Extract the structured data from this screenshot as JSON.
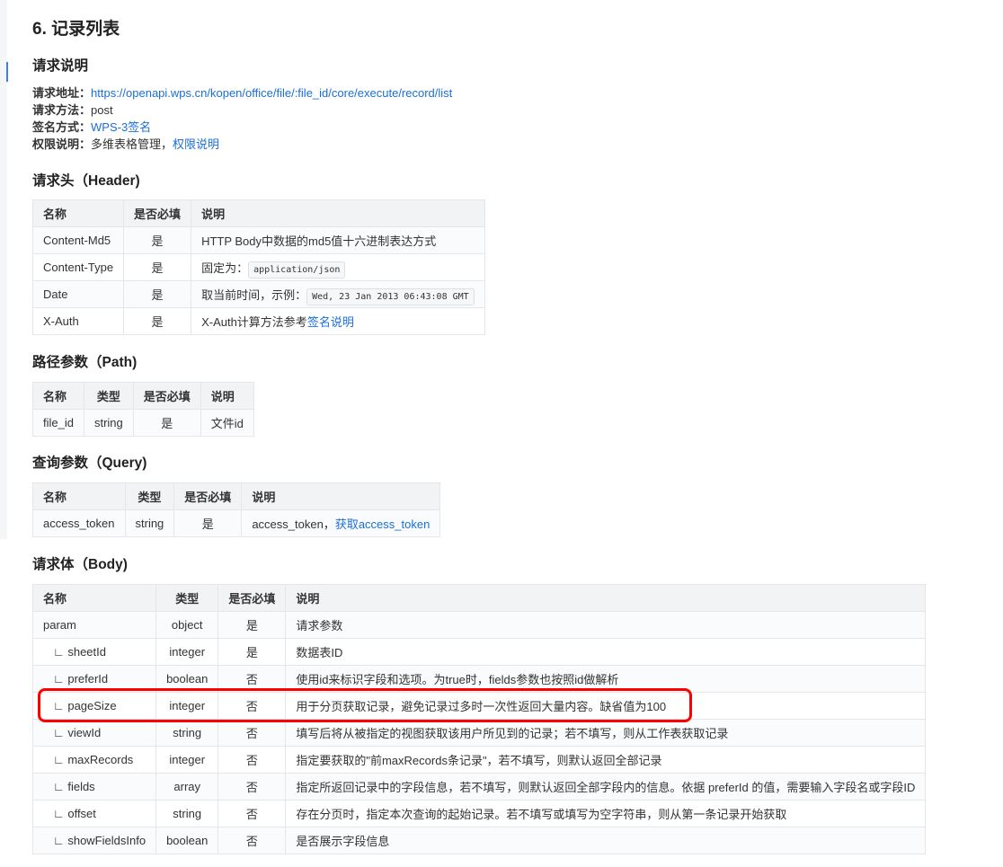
{
  "title": "6. 记录列表",
  "request_desc": {
    "heading": "请求说明",
    "rows": [
      {
        "label": "请求地址：",
        "value": "",
        "link": "https://openapi.wps.cn/kopen/office/file/:file_id/core/execute/record/list"
      },
      {
        "label": "请求方法：",
        "value": "post",
        "link": ""
      },
      {
        "label": "签名方式：",
        "value": "",
        "link": "WPS-3签名"
      },
      {
        "label": "权限说明：",
        "value": "多维表格管理，",
        "link": "权限说明"
      }
    ]
  },
  "header_section": {
    "heading": "请求头（Header)",
    "columns": [
      "名称",
      "是否必填",
      "说明"
    ],
    "rows": [
      {
        "cells": [
          "Content-Md5",
          "是"
        ],
        "desc": "HTTP Body中数据的md5值十六进制表达方式",
        "code": "",
        "link": ""
      },
      {
        "cells": [
          "Content-Type",
          "是"
        ],
        "desc": "固定为：",
        "code": "application/json",
        "link": ""
      },
      {
        "cells": [
          "Date",
          "是"
        ],
        "desc": "取当前时间，示例：",
        "code": "Wed, 23 Jan 2013 06:43:08 GMT",
        "link": ""
      },
      {
        "cells": [
          "X-Auth",
          "是"
        ],
        "desc": "X-Auth计算方法参考",
        "code": "",
        "link": "签名说明"
      }
    ]
  },
  "path_section": {
    "heading": "路径参数（Path)",
    "columns": [
      "名称",
      "类型",
      "是否必填",
      "说明"
    ],
    "rows": [
      {
        "cells": [
          "file_id",
          "string",
          "是"
        ],
        "desc": "文件id",
        "code": "",
        "link": ""
      }
    ]
  },
  "query_section": {
    "heading": "查询参数（Query)",
    "columns": [
      "名称",
      "类型",
      "是否必填",
      "说明"
    ],
    "rows": [
      {
        "cells": [
          "access_token",
          "string",
          "是"
        ],
        "desc": "access_token，",
        "code": "",
        "link": "获取access_token"
      }
    ]
  },
  "body_section": {
    "heading": "请求体（Body)",
    "columns": [
      "名称",
      "类型",
      "是否必填",
      "说明"
    ],
    "rows": [
      {
        "cells": [
          "param",
          "object",
          "是"
        ],
        "desc": "请求参数",
        "code": "",
        "link": ""
      },
      {
        "cells": [
          "∟ sheetId",
          "integer",
          "是"
        ],
        "desc": "数据表ID",
        "code": "",
        "link": ""
      },
      {
        "cells": [
          "∟ preferId",
          "boolean",
          "否"
        ],
        "desc": "使用id来标识字段和选项。为true时，fields参数也按照id做解析",
        "code": "",
        "link": ""
      },
      {
        "cells": [
          "∟ pageSize",
          "integer",
          "否"
        ],
        "desc": "用于分页获取记录，避免记录过多时一次性返回大量内容。缺省值为100",
        "code": "",
        "link": "",
        "highlighted": true
      },
      {
        "cells": [
          "∟ viewId",
          "string",
          "否"
        ],
        "desc": "填写后将从被指定的视图获取该用户所见到的记录；若不填写，则从工作表获取记录",
        "code": "",
        "link": ""
      },
      {
        "cells": [
          "∟ maxRecords",
          "integer",
          "否"
        ],
        "desc": "指定要获取的\"前maxRecords条记录\"，若不填写，则默认返回全部记录",
        "code": "",
        "link": ""
      },
      {
        "cells": [
          "∟ fields",
          "array",
          "否"
        ],
        "desc": "指定所返回记录中的字段信息，若不填写，则默认返回全部字段内的信息。依据 preferId 的值，需要输入字段名或字段ID",
        "code": "",
        "link": ""
      },
      {
        "cells": [
          "∟ offset",
          "string",
          "否"
        ],
        "desc": "存在分页时，指定本次查询的起始记录。若不填写或填写为空字符串，则从第一条记录开始获取",
        "code": "",
        "link": ""
      },
      {
        "cells": [
          "∟ showFieldsInfo",
          "boolean",
          "否"
        ],
        "desc": "是否展示字段信息",
        "code": "",
        "link": ""
      }
    ]
  },
  "colors": {
    "link": "#1a6fd8",
    "highlight": "#ff0000",
    "indicator": "#3b7cff"
  }
}
